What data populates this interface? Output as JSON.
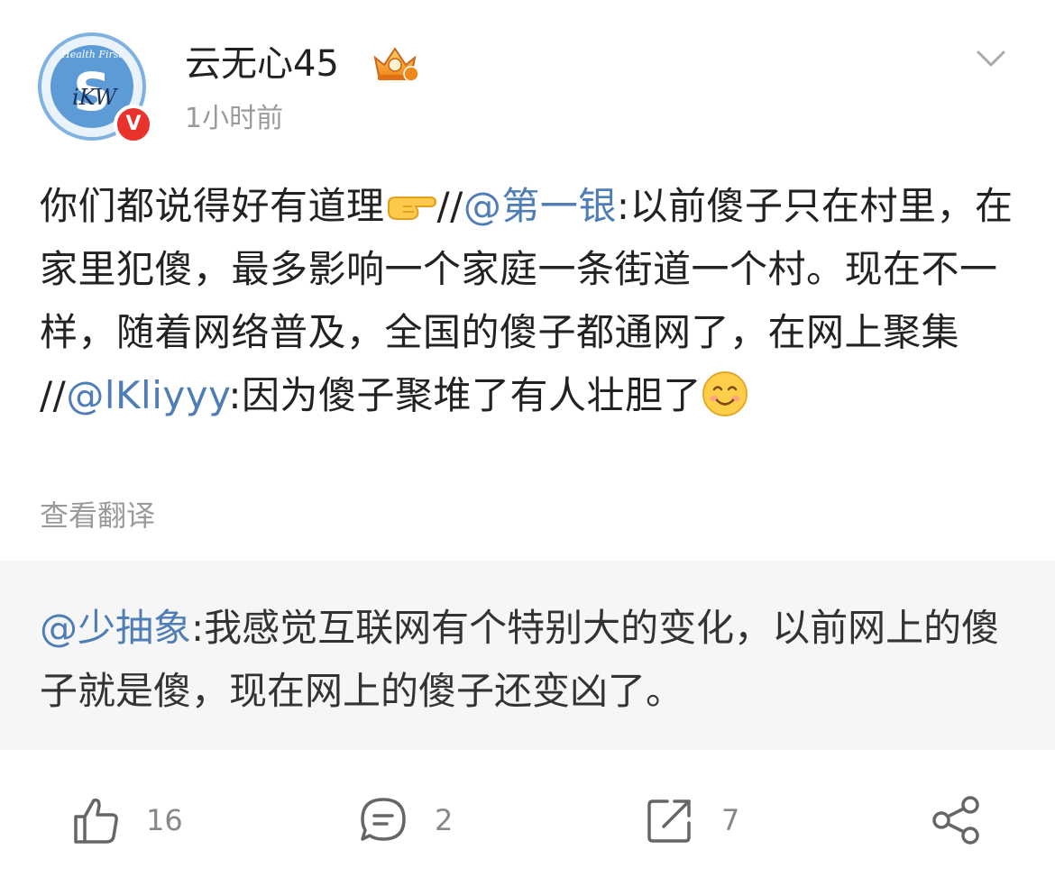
{
  "post": {
    "author": {
      "name": "云无心45",
      "avatar_ring_text": "Health First",
      "avatar_letter": "S",
      "avatar_signature": "iKW",
      "verified_label": "V",
      "verified_color": "#e8322b"
    },
    "time": "1小时前",
    "text_segments": {
      "s1": "你们都说得好有道理",
      "s2": "//",
      "s3": "@第一银",
      "s4": ":以前傻子只在村里，在家里犯傻，最多影响一个家庭一条街道一个村。现在不一样，随着网络普及，全国的傻子都通网了，在网上聚集 //",
      "s5": "@lKliyyy",
      "s6": ":因为傻子聚堆了有人壮胆了"
    },
    "emoji": [
      "backhand-index-pointing-right-icon",
      "smiling-face-icon"
    ],
    "translate_label": "查看翻译"
  },
  "quote": {
    "mention": "@少抽象",
    "text": ":我感觉互联网有个特别大的变化，以前网上的傻子就是傻，现在网上的傻子还变凶了。"
  },
  "actions": {
    "like_count": "16",
    "comment_count": "2",
    "repost_count": "7"
  },
  "colors": {
    "mention": "#4f7db5",
    "muted_text": "#9a9a9a",
    "quote_background": "#f6f6f6"
  }
}
